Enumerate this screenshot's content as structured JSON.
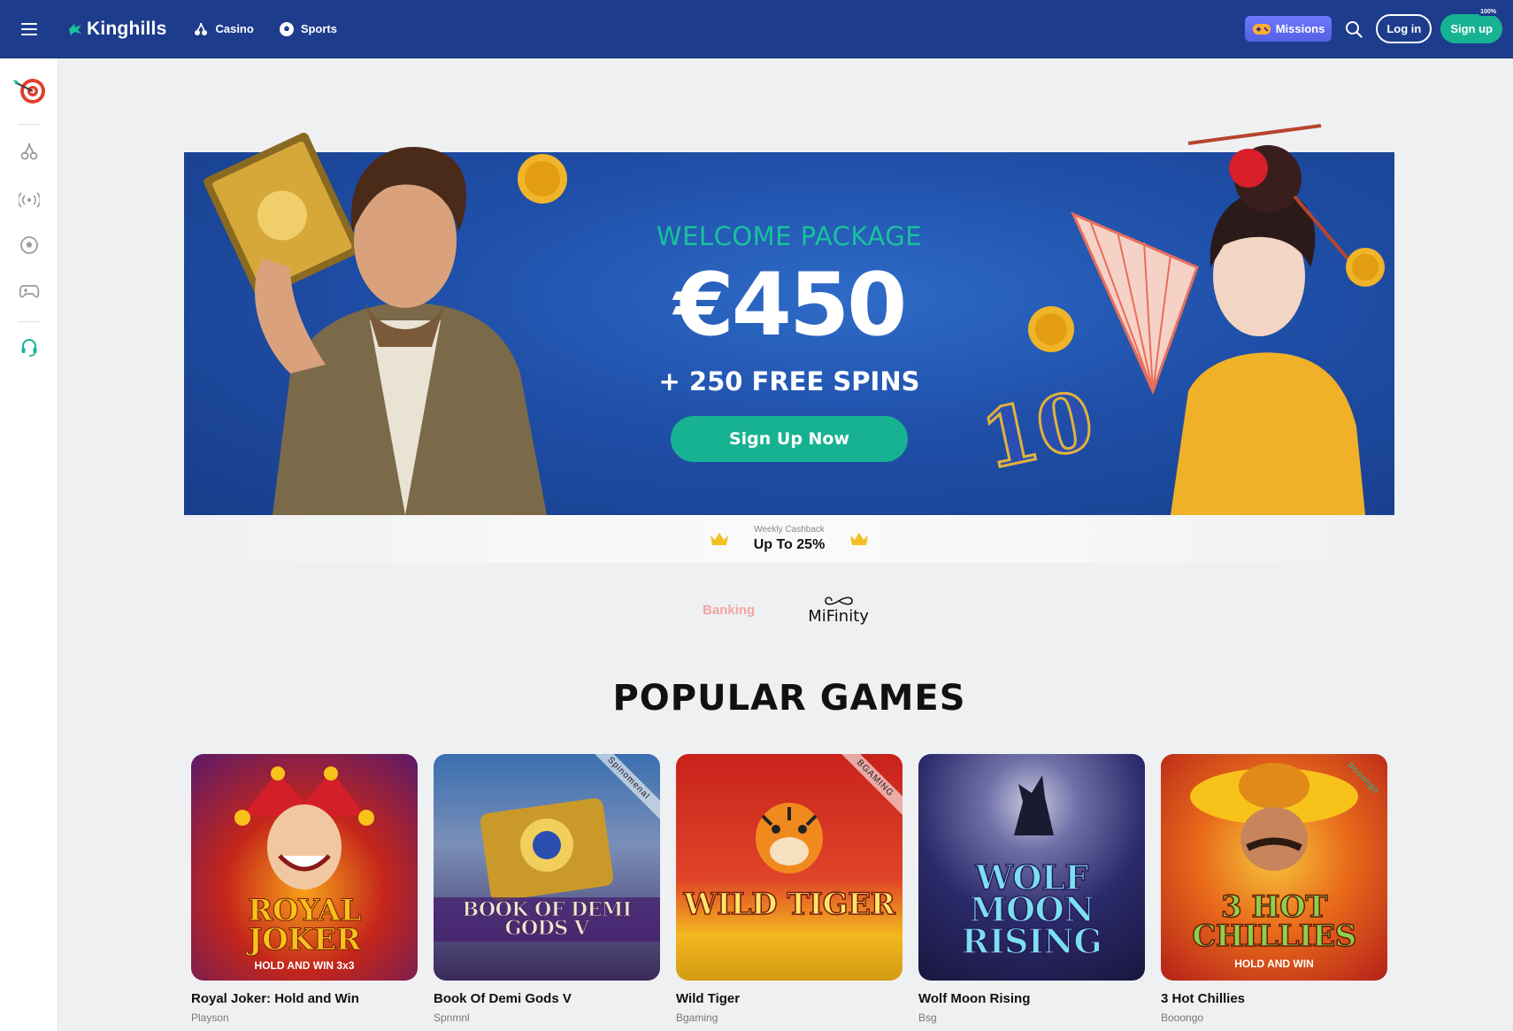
{
  "header": {
    "logo_text": "Kinghills",
    "nav": [
      {
        "label": "Casino",
        "icon": "cherry-icon"
      },
      {
        "label": "Sports",
        "icon": "soccer-ball-icon"
      }
    ],
    "missions_label": "Missions",
    "login_label": "Log in",
    "signup_label": "Sign up",
    "signup_badge": "100%"
  },
  "sidebar": {
    "items": [
      {
        "icon": "dart-target-icon"
      },
      {
        "icon": "cherry-icon"
      },
      {
        "icon": "live-broadcast-icon"
      },
      {
        "icon": "soccer-ball-icon"
      },
      {
        "icon": "gamepad-icon"
      },
      {
        "icon": "support-headset-icon"
      }
    ]
  },
  "banner": {
    "eyebrow": "WELCOME PACKAGE",
    "amount": "€450",
    "spins": "+ 250 FREE SPINS",
    "cta_label": "Sign Up Now"
  },
  "promo": {
    "sub": "Weekly Cashback",
    "main": "Up To 25%"
  },
  "banking": {
    "label": "Banking",
    "provider": "MiFinity"
  },
  "popular": {
    "title": "POPULAR GAMES",
    "games": [
      {
        "name": "Royal Joker: Hold and Win",
        "provider": "Playson",
        "art_title": "ROYAL JOKER",
        "art_sub": "HOLD AND WIN 3x3"
      },
      {
        "name": "Book Of Demi Gods V",
        "provider": "Spnmnl",
        "art_title": "BOOK OF DEMI GODS V",
        "ribbon": "Spinomenal"
      },
      {
        "name": "Wild Tiger",
        "provider": "Bgaming",
        "art_title": "WILD TIGER",
        "ribbon": "BGAMING"
      },
      {
        "name": "Wolf Moon Rising",
        "provider": "Bsg",
        "art_title": "WOLF MOON RISING"
      },
      {
        "name": "3 Hot Chillies",
        "provider": "Booongo",
        "art_title": "3 HOT CHILLIES",
        "art_sub": "HOLD AND WIN",
        "ribbon": "booongo"
      }
    ]
  },
  "colors": {
    "header_bg": "#1d3c8c",
    "accent_green": "#17b292",
    "missions": "#5e69f2",
    "banner_blue": "#1f4fa8"
  }
}
